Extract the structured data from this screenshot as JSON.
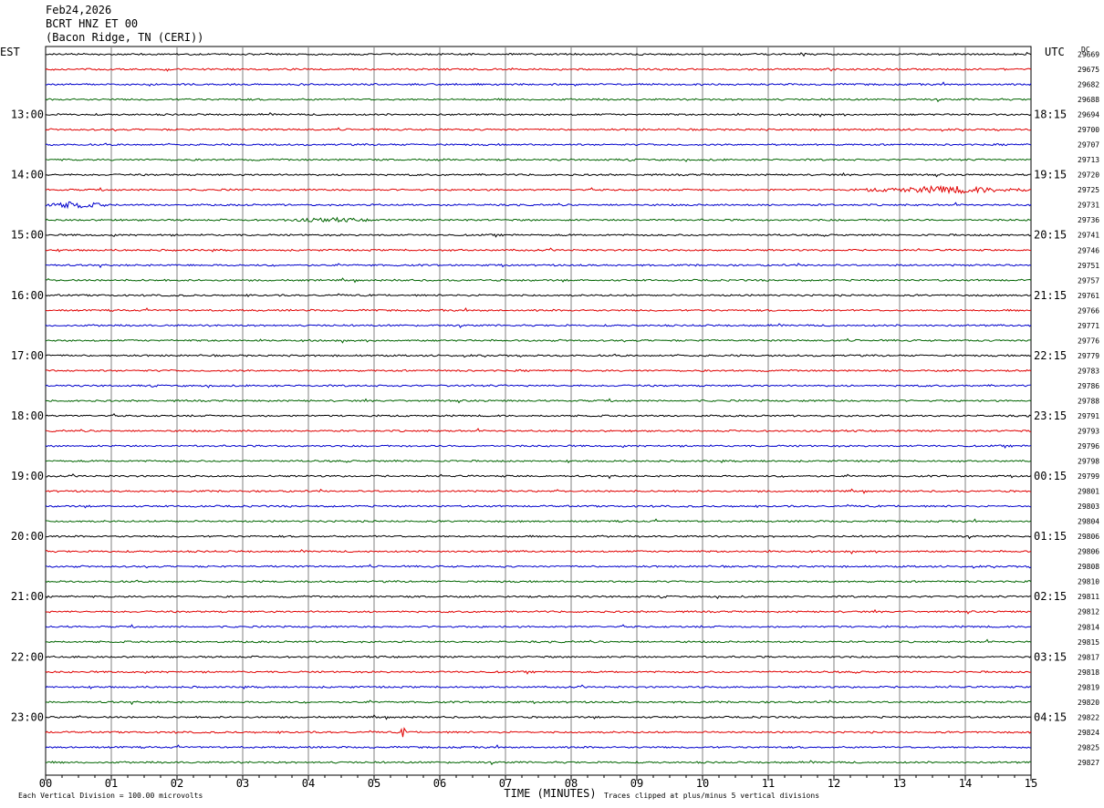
{
  "header": {
    "date": "Feb24,2026",
    "station": "BCRT HNZ ET 00",
    "location": "(Bacon Ridge, TN (CERI))"
  },
  "chart_data": {
    "type": "line",
    "title": "BCRT HNZ ET 00",
    "left_axis_label": "EST",
    "right_axis_label": "UTC",
    "dc_label": "DC",
    "xlabel": "TIME (MINUTES)",
    "x_ticks": [
      "00",
      "01",
      "02",
      "03",
      "04",
      "05",
      "06",
      "07",
      "08",
      "09",
      "10",
      "11",
      "12",
      "13",
      "14",
      "15"
    ],
    "xlim": [
      0,
      15
    ],
    "footer_left": "Each Vertical Division =  100.00 microvolts",
    "footer_right": "Traces clipped at plus/minus 5 vertical divisions",
    "trace_colors": [
      "#000000",
      "#e00000",
      "#0000cc",
      "#006400"
    ],
    "hour_labels_est": [
      "13:00",
      "14:00",
      "15:00",
      "16:00",
      "17:00",
      "18:00",
      "19:00",
      "20:00",
      "21:00",
      "22:00",
      "23:00"
    ],
    "hour_labels_utc": [
      "18:15",
      "19:15",
      "20:15",
      "21:15",
      "22:15",
      "23:15",
      "00:15",
      "01:15",
      "02:15",
      "03:15",
      "04:15"
    ],
    "dc_values": [
      "29669",
      "29675",
      "29682",
      "29688",
      "29694",
      "29700",
      "29707",
      "29713",
      "29720",
      "29725",
      "29731",
      "29736",
      "29741",
      "29746",
      "29751",
      "29757",
      "29761",
      "29766",
      "29771",
      "29776",
      "29779",
      "29783",
      "29786",
      "29788",
      "29791",
      "29793",
      "29796",
      "29798",
      "29799",
      "29801",
      "29803",
      "29804",
      "29806",
      "29806",
      "29808",
      "29810",
      "29811",
      "29812",
      "29814",
      "29815",
      "29817",
      "29818",
      "29819",
      "29820",
      "29822",
      "29824",
      "29825",
      "29827"
    ],
    "events": [
      {
        "trace": 9,
        "start_min": 12.5,
        "end_min": 15.0,
        "amplitude": "moderate"
      },
      {
        "trace": 10,
        "start_min": 0.0,
        "end_min": 0.9,
        "amplitude": "moderate"
      },
      {
        "trace": 11,
        "start_min": 3.6,
        "end_min": 5.0,
        "amplitude": "small"
      },
      {
        "trace": 45,
        "start_min": 5.4,
        "end_min": 5.5,
        "amplitude": "spike"
      }
    ]
  }
}
